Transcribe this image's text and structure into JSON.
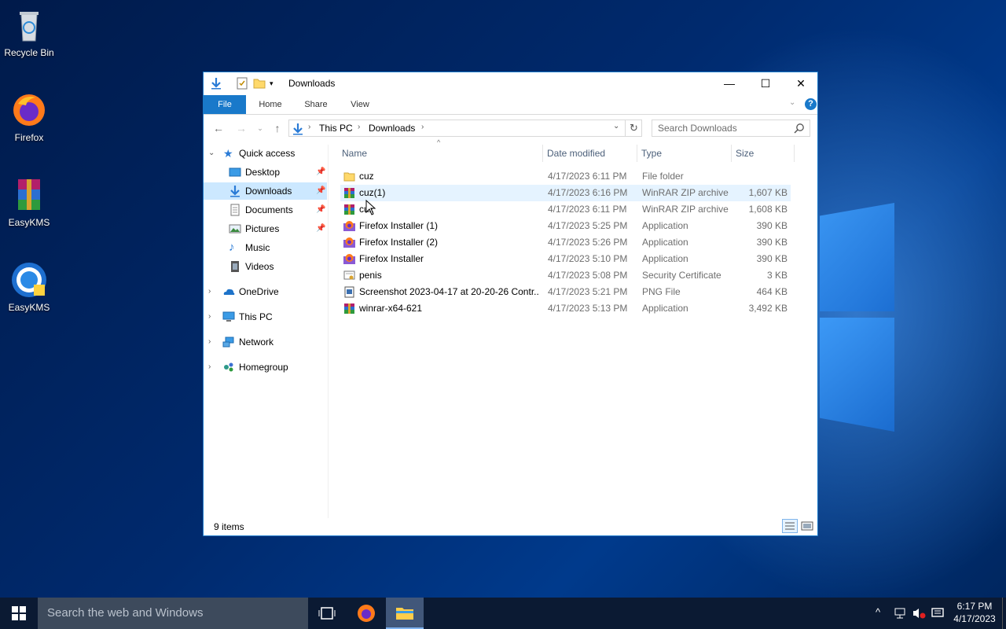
{
  "desktop": {
    "icons": [
      {
        "label": "Recycle Bin",
        "icon": "recycle-bin-icon"
      },
      {
        "label": "Firefox",
        "icon": "firefox-icon"
      },
      {
        "label": "EasyKMS",
        "icon": "winrar-icon"
      },
      {
        "label": "EasyKMS",
        "icon": "easykms-icon"
      }
    ]
  },
  "window": {
    "title": "Downloads",
    "ribbon_tabs": {
      "file": "File",
      "home": "Home",
      "share": "Share",
      "view": "View"
    },
    "address": {
      "crumb1": "This PC",
      "crumb2": "Downloads"
    },
    "search": {
      "placeholder": "Search Downloads"
    },
    "nav": {
      "quick_access": "Quick access",
      "desktop": "Desktop",
      "downloads": "Downloads",
      "documents": "Documents",
      "pictures": "Pictures",
      "music": "Music",
      "videos": "Videos",
      "onedrive": "OneDrive",
      "this_pc": "This PC",
      "network": "Network",
      "homegroup": "Homegroup"
    },
    "columns": {
      "name": "Name",
      "date": "Date modified",
      "type": "Type",
      "size": "Size"
    },
    "files": [
      {
        "name": "cuz",
        "date": "4/17/2023 6:11 PM",
        "type": "File folder",
        "size": "",
        "icon": "folder-icon"
      },
      {
        "name": "cuz(1)",
        "date": "4/17/2023 6:16 PM",
        "type": "WinRAR ZIP archive",
        "size": "1,607 KB",
        "icon": "zip-archive-icon"
      },
      {
        "name": "cuz",
        "date": "4/17/2023 6:11 PM",
        "type": "WinRAR ZIP archive",
        "size": "1,608 KB",
        "icon": "zip-archive-icon"
      },
      {
        "name": "Firefox Installer (1)",
        "date": "4/17/2023 5:25 PM",
        "type": "Application",
        "size": "390 KB",
        "icon": "firefox-installer-icon"
      },
      {
        "name": "Firefox Installer (2)",
        "date": "4/17/2023 5:26 PM",
        "type": "Application",
        "size": "390 KB",
        "icon": "firefox-installer-icon"
      },
      {
        "name": "Firefox Installer",
        "date": "4/17/2023 5:10 PM",
        "type": "Application",
        "size": "390 KB",
        "icon": "firefox-installer-icon"
      },
      {
        "name": "penis",
        "date": "4/17/2023 5:08 PM",
        "type": "Security Certificate",
        "size": "3 KB",
        "icon": "certificate-icon"
      },
      {
        "name": "Screenshot 2023-04-17 at 20-20-26 Contr...",
        "date": "4/17/2023 5:21 PM",
        "type": "PNG File",
        "size": "464 KB",
        "icon": "png-file-icon"
      },
      {
        "name": "winrar-x64-621",
        "date": "4/17/2023 5:13 PM",
        "type": "Application",
        "size": "3,492 KB",
        "icon": "winrar-installer-icon"
      }
    ],
    "status": "9 items"
  },
  "taskbar": {
    "search_placeholder": "Search the web and Windows",
    "time": "6:17 PM",
    "date": "4/17/2023"
  }
}
